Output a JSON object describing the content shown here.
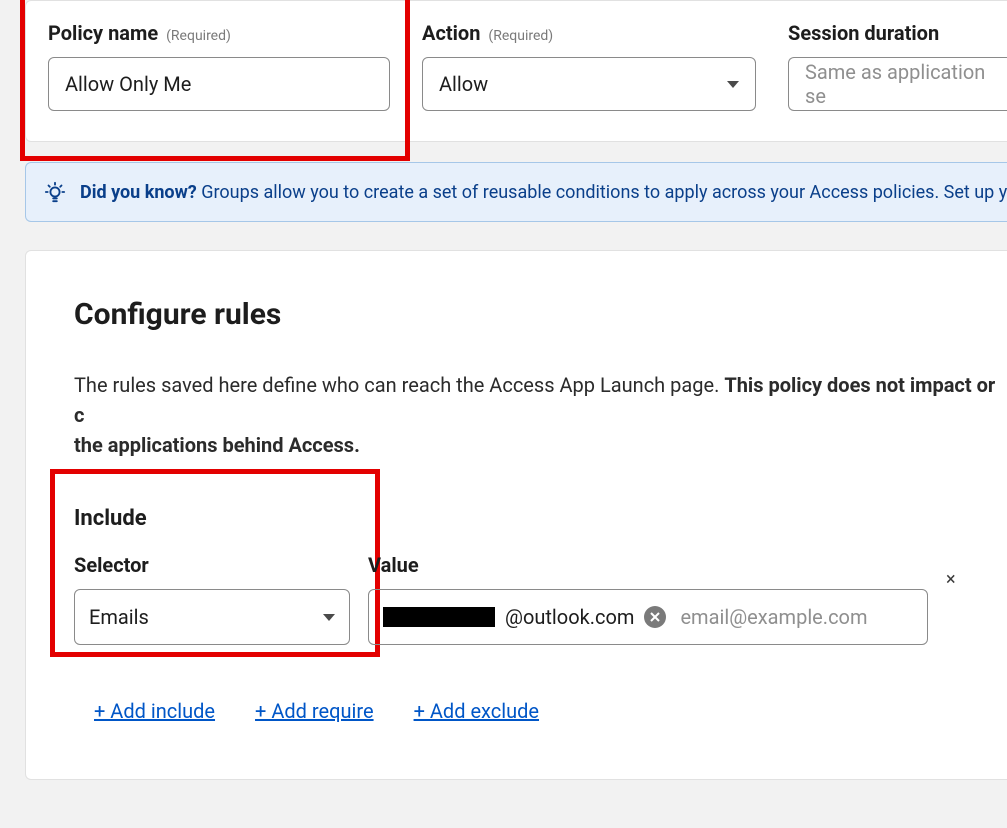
{
  "top": {
    "policy_name": {
      "label": "Policy name",
      "required": "(Required)",
      "value": "Allow Only Me"
    },
    "action": {
      "label": "Action",
      "required": "(Required)",
      "value": "Allow"
    },
    "session": {
      "label": "Session duration",
      "placeholder": "Same as application se"
    }
  },
  "banner": {
    "lead": "Did you know?",
    "text": "Groups allow you to create a set of reusable conditions to apply across your Access policies. Set up your"
  },
  "rules": {
    "heading": "Configure rules",
    "desc_plain": "The rules saved here define who can reach the Access App Launch page. ",
    "desc_bold": "This policy does not impact or c",
    "desc_bold2": "the applications behind Access.",
    "include_heading": "Include",
    "selector_label": "Selector",
    "selector_value": "Emails",
    "value_label": "Value",
    "chip_suffix": "@outlook.com",
    "value_placeholder": "email@example.com",
    "remove_row": "×",
    "add_include": "+ Add include",
    "add_require": "+ Add require",
    "add_exclude": "+ Add exclude"
  }
}
